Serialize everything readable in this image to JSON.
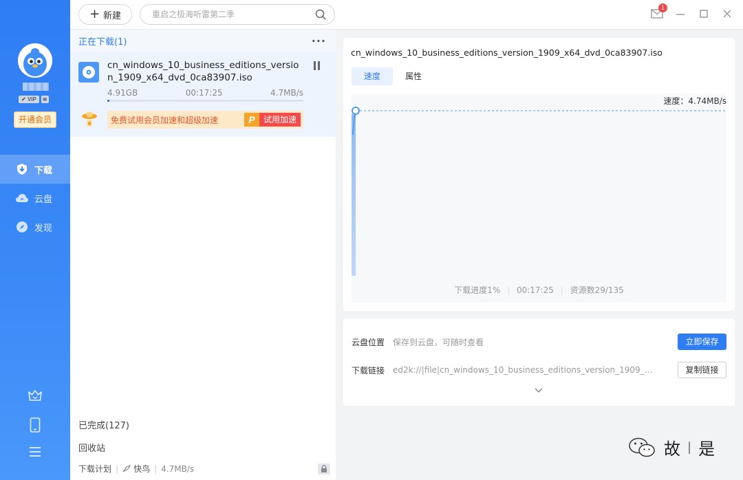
{
  "sidebar": {
    "vip_label": "VIP",
    "vip_level": "≋",
    "open_vip": "开通会员",
    "nav": [
      {
        "id": "download",
        "label": "下载",
        "icon": "download-shield-icon",
        "active": true
      },
      {
        "id": "cloud",
        "label": "云盘",
        "icon": "cloud-icon",
        "active": false
      },
      {
        "id": "discover",
        "label": "发现",
        "icon": "compass-icon",
        "active": false
      }
    ],
    "bottom_icons": [
      "crown-icon",
      "phone-icon",
      "menu-icon"
    ]
  },
  "topbar": {
    "new_label": "新建",
    "search_placeholder": "重启之极海听雷第二季",
    "mail_count": "1"
  },
  "middle": {
    "downloading_title": "正在下载(1)",
    "item": {
      "name": "cn_windows_10_business_editions_version_1909_x64_dvd_0ca83907.iso",
      "size": "4.91GB",
      "time_left": "00:17:25",
      "speed": "4.7MB/s",
      "progress": 0.01
    },
    "promo": {
      "text": "免费试用会员加速和超级加速",
      "btn_icon": "P",
      "btn_label": "试用加速"
    },
    "completed": "已完成(127)",
    "recycle": "回收站",
    "status": {
      "plan": "下载计划",
      "mode": "快鸟",
      "speed": "4.7MB/s"
    }
  },
  "detail": {
    "title": "cn_windows_10_business_editions_version_1909_x64_dvd_0ca83907.iso",
    "tabs": [
      {
        "label": "速度",
        "active": true
      },
      {
        "label": "属性",
        "active": false
      }
    ],
    "speed_label": "速度：4.74MB/s",
    "stats": {
      "progress": "下载进度1%",
      "time": "00:17:25",
      "sources": "资源数29/135"
    },
    "cloud_location_label": "云盘位置",
    "cloud_location_value": "保存到云盘，可随时查看",
    "save_now": "立即保存",
    "link_label": "下载链接",
    "link_value": "ed2k://|file|cn_windows_10_business_editions_version_1909_x6...",
    "copy_link": "复制链接"
  },
  "watermark": {
    "left": "故",
    "right": "是"
  },
  "colors": {
    "accent": "#2f7df3",
    "promo_bg": "#fde8c8",
    "promo_btn": "#f34b4b",
    "vip_btn_text": "#e36b00"
  }
}
